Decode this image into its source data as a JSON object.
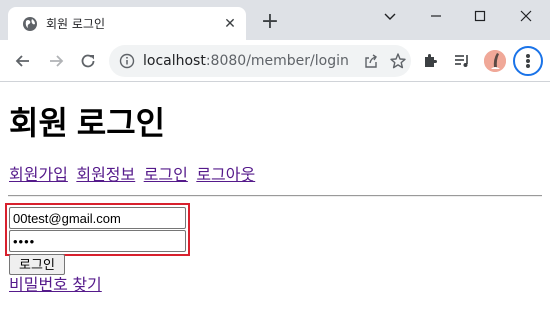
{
  "browser": {
    "tab": {
      "title": "회원 로그인",
      "favicon": "globe-icon",
      "close_icon": "close-icon"
    },
    "new_tab_icon": "plus-icon",
    "window_controls": [
      "tab-search-icon",
      "minimize-icon",
      "maximize-icon",
      "close-icon"
    ],
    "toolbar": {
      "back_icon": "back-arrow-icon",
      "forward_icon": "forward-arrow-icon",
      "reload_icon": "reload-icon",
      "url_host": "localhost",
      "url_path": ":8080/member/login",
      "site_info_icon": "info-icon",
      "share_icon": "share-icon",
      "bookmark_icon": "star-icon",
      "extensions_icon": "puzzle-icon",
      "media_icon": "media-queue-icon",
      "profile_icon": "avatar",
      "menu_icon": "kebab-menu-icon"
    }
  },
  "page": {
    "title": "회원 로그인",
    "nav_links": [
      "회원가입",
      "회원정보",
      "로그인",
      "로그아웃"
    ],
    "form": {
      "email_value": "00test@gmail.com",
      "password_value": "1234",
      "submit_label": "로그인"
    },
    "find_password_link": "비밀번호 찾기"
  },
  "colors": {
    "chrome_bg": "#dee1e6",
    "link_visited": "#551a8b",
    "highlight_border": "#d8212e",
    "focus_ring": "#1a73e8"
  }
}
